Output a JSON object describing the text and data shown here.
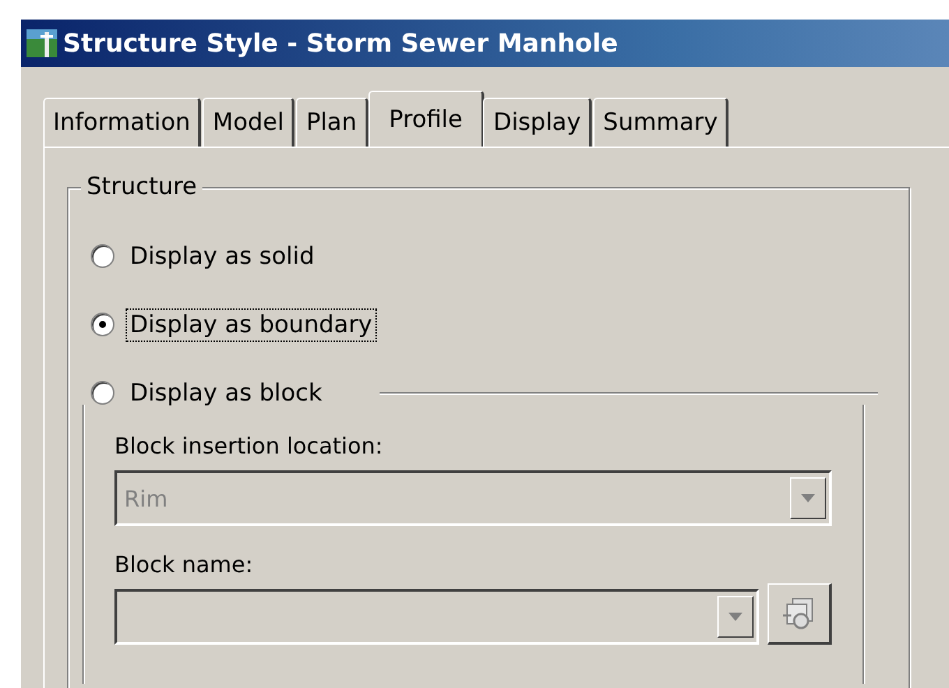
{
  "window": {
    "title": "Structure Style - Storm Sewer Manhole"
  },
  "tabs": [
    {
      "label": "Information",
      "selected": false
    },
    {
      "label": "Model",
      "selected": false
    },
    {
      "label": "Plan",
      "selected": false
    },
    {
      "label": "Profile",
      "selected": true
    },
    {
      "label": "Display",
      "selected": false
    },
    {
      "label": "Summary",
      "selected": false
    }
  ],
  "structure": {
    "title": "Structure",
    "options": [
      {
        "label": "Display as solid",
        "selected": false,
        "focused": false
      },
      {
        "label": "Display as boundary",
        "selected": true,
        "focused": true
      },
      {
        "label": "Display as block",
        "selected": false,
        "focused": false
      }
    ],
    "block": {
      "location_label": "Block insertion location:",
      "location": {
        "value": "Rim",
        "disabled": true
      },
      "name_label": "Block name:"
    }
  }
}
